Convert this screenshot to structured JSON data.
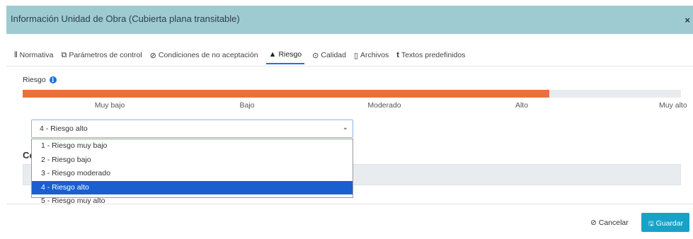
{
  "dialog": {
    "title": "Información Unidad de Obra (Cubierta plana transitable)",
    "close_label": "×"
  },
  "tabs": [
    {
      "label": "Normativa",
      "icon": "sliders-icon",
      "glyph": "⫴"
    },
    {
      "label": "Parámetros de control",
      "icon": "copy-icon",
      "glyph": "⧉"
    },
    {
      "label": "Condiciones de no aceptación",
      "icon": "ban-icon",
      "glyph": "⊘"
    },
    {
      "label": "Riesgo",
      "icon": "warning-icon",
      "glyph": "▲",
      "active": true
    },
    {
      "label": "Calidad",
      "icon": "check-circle-icon",
      "glyph": "⊙"
    },
    {
      "label": "Archivos",
      "icon": "file-icon",
      "glyph": "▯"
    },
    {
      "label": "Textos predefinidos",
      "icon": "text-icon",
      "glyph": "t"
    }
  ],
  "risk": {
    "label": "Riesgo",
    "info_glyph": "i",
    "level": 4,
    "max_level": 5,
    "fill_color": "#e8713d",
    "ticks": [
      "Muy bajo",
      "Bajo",
      "Moderado",
      "Alto",
      "Muy alto"
    ]
  },
  "select": {
    "value": "4 - Riesgo alto",
    "caret": "⌄",
    "options": [
      "1 - Riesgo muy bajo",
      "2 - Riesgo bajo",
      "3 - Riesgo moderado",
      "4 - Riesgo alto",
      "5 - Riesgo muy alto"
    ],
    "selected_index": 3
  },
  "section": {
    "title": "Co"
  },
  "footer": {
    "cancel_label": "Cancelar",
    "cancel_glyph": "⊘",
    "save_label": "Guardar",
    "save_glyph": "🖫"
  },
  "colors": {
    "header_bg": "#9ecbd2",
    "accent": "#1a73e8",
    "save_bg": "#17a2c8",
    "selected_option": "#1a5fd0"
  }
}
